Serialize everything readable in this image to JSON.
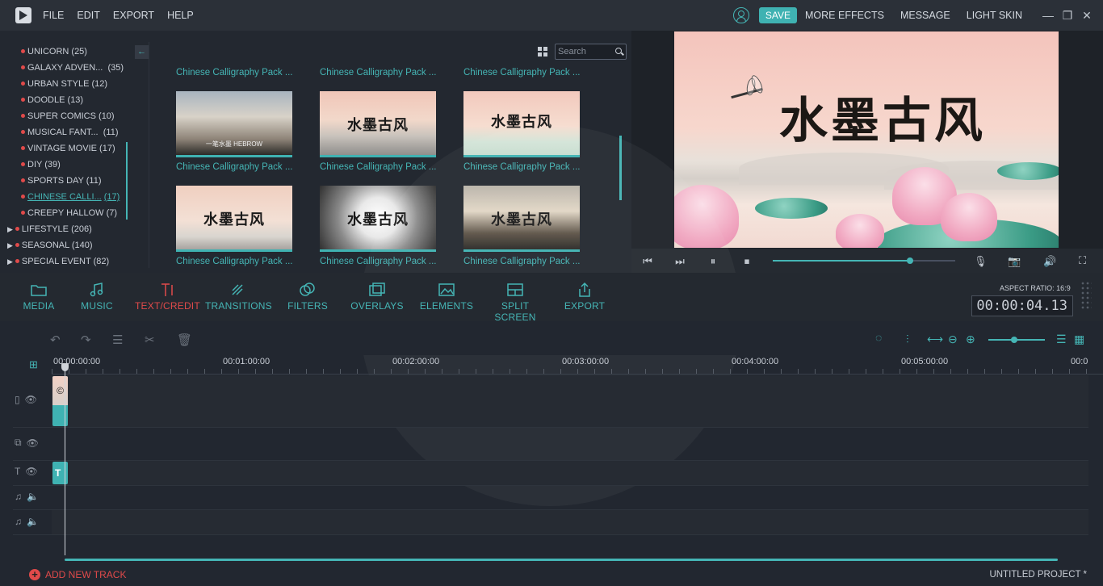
{
  "menu": [
    "FILE",
    "EDIT",
    "EXPORT",
    "HELP"
  ],
  "topbar": {
    "save_label": "SAVE",
    "more_effects": "MORE EFFECTS",
    "message": "MESSAGE",
    "light_skin": "LIGHT SKIN"
  },
  "categories": {
    "sub": [
      {
        "name": "UNICORN",
        "count": "(25)"
      },
      {
        "name": "GALAXY ADVEN...",
        "count": "(35)"
      },
      {
        "name": "URBAN STYLE",
        "count": "(12)"
      },
      {
        "name": "DOODLE",
        "count": "(13)"
      },
      {
        "name": "SUPER COMICS",
        "count": "(10)"
      },
      {
        "name": "MUSICAL FANT...",
        "count": "(11)"
      },
      {
        "name": "VINTAGE MOVIE",
        "count": "(17)"
      },
      {
        "name": "DIY",
        "count": "(39)"
      },
      {
        "name": "SPORTS DAY",
        "count": "(11)"
      },
      {
        "name": "CHINESE CALLI...",
        "count": "(17)"
      },
      {
        "name": "CREEPY HALLOW",
        "count": "(7)"
      }
    ],
    "top": [
      {
        "name": "LIFESTYLE",
        "count": "(206)"
      },
      {
        "name": "SEASONAL",
        "count": "(140)"
      },
      {
        "name": "SPECIAL EVENT",
        "count": "(82)"
      }
    ]
  },
  "search": {
    "placeholder": "Search"
  },
  "thumbnails": {
    "label": "Chinese Calligraphy Pack ...",
    "calligraphy": "水墨古风",
    "caption": "一笔水墨  HEBROW"
  },
  "preview": {
    "title": "水墨古风"
  },
  "tools": [
    "MEDIA",
    "MUSIC",
    "TEXT/CREDIT",
    "TRANSITIONS",
    "FILTERS",
    "OVERLAYS",
    "ELEMENTS",
    "SPLIT SCREEN",
    "EXPORT"
  ],
  "aspect_ratio": "ASPECT RATIO: 16:9",
  "timecode": "00:00:04.13",
  "ruler": [
    "00:00:00:00",
    "00:01:00:00",
    "00:02:00:00",
    "00:03:00:00",
    "00:04:00:00",
    "00:05:00:00",
    "00:0"
  ],
  "playback_progress": 0.75,
  "zoom_level": 0.45,
  "clips": {
    "video_glyph": "©",
    "text_glyph": "T"
  },
  "status": {
    "add_track": "ADD NEW TRACK",
    "project": "UNTITLED PROJECT *"
  }
}
